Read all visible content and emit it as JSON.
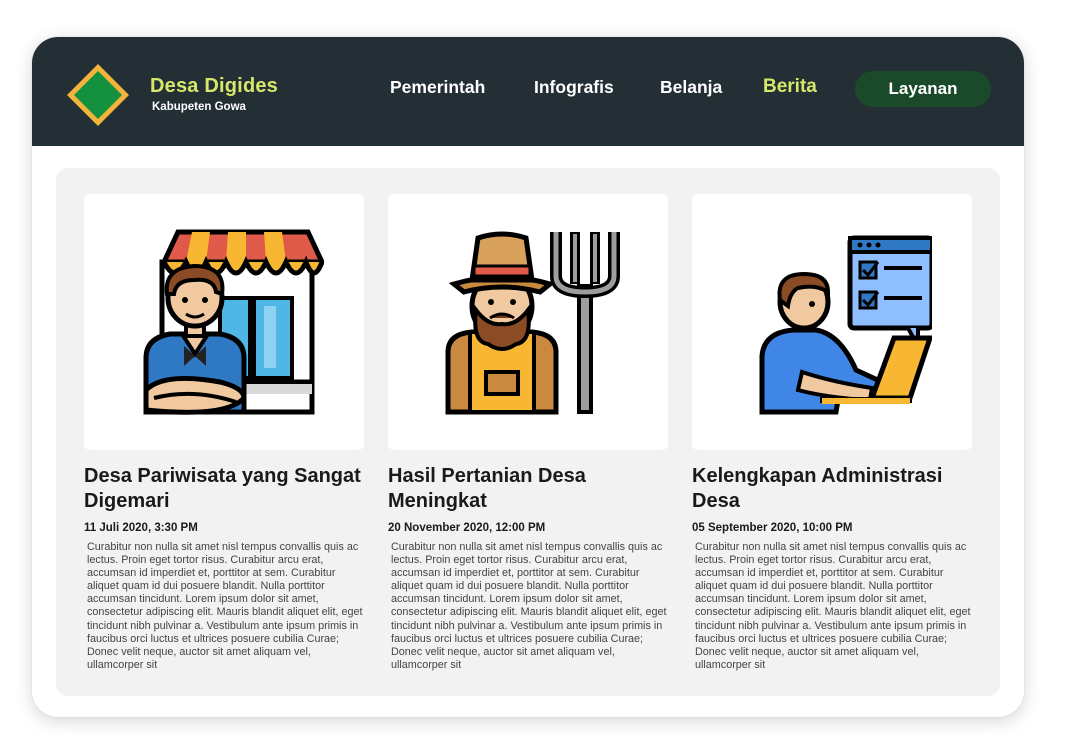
{
  "header": {
    "brand_title": "Desa Digides",
    "brand_subtitle": "Kabupeten Gowa",
    "nav": [
      {
        "label": "Pemerintah"
      },
      {
        "label": "Infografis"
      },
      {
        "label": "Belanja"
      },
      {
        "label": "Berita"
      }
    ],
    "active_nav": "Berita",
    "cta_label": "Layanan"
  },
  "colors": {
    "header_bg": "#232e35",
    "accent": "#d6e86a",
    "cta_bg": "#1b4a2a",
    "logo_outer": "#f4b43c",
    "logo_inner": "#13913f"
  },
  "articles": [
    {
      "icon": "shopkeeper-icon",
      "title": "Desa Pariwisata yang Sangat Digemari",
      "date": "11 Juli 2020, 3:30 PM",
      "body": "Curabitur non nulla sit amet nisl tempus convallis quis ac lectus. Proin eget tortor risus. Curabitur arcu erat, accumsan id imperdiet et, porttitor at sem. Curabitur aliquet quam id dui posuere blandit. Nulla porttitor accumsan tincidunt. Lorem ipsum dolor sit amet, consectetur adipiscing elit. Mauris blandit aliquet elit, eget tincidunt nibh pulvinar a. Vestibulum ante ipsum primis in faucibus orci luctus et ultrices posuere cubilia Curae; Donec velit neque, auctor sit amet aliquam vel, ullamcorper sit"
    },
    {
      "icon": "farmer-icon",
      "title": "Hasil Pertanian Desa Meningkat",
      "date": "20 November 2020, 12:00 PM",
      "body": "Curabitur non nulla sit amet nisl tempus convallis quis ac lectus. Proin eget tortor risus. Curabitur arcu erat, accumsan id imperdiet et, porttitor at sem. Curabitur aliquet quam id dui posuere blandit. Nulla porttitor accumsan tincidunt. Lorem ipsum dolor sit amet, consectetur adipiscing elit. Mauris blandit aliquet elit, eget tincidunt nibh pulvinar a. Vestibulum ante ipsum primis in faucibus orci luctus et ultrices posuere cubilia Curae; Donec velit neque, auctor sit amet aliquam vel, ullamcorper sit"
    },
    {
      "icon": "online-admin-icon",
      "title": "Kelengkapan Administrasi Desa",
      "date": "05 September 2020, 10:00 PM",
      "body": "Curabitur non nulla sit amet nisl tempus convallis quis ac lectus. Proin eget tortor risus. Curabitur arcu erat, accumsan id imperdiet et, porttitor at sem. Curabitur aliquet quam id dui posuere blandit. Nulla porttitor accumsan tincidunt. Lorem ipsum dolor sit amet, consectetur adipiscing elit. Mauris blandit aliquet elit, eget tincidunt nibh pulvinar a. Vestibulum ante ipsum primis in faucibus orci luctus et ultrices posuere cubilia Curae; Donec velit neque, auctor sit amet aliquam vel, ullamcorper sit"
    }
  ]
}
